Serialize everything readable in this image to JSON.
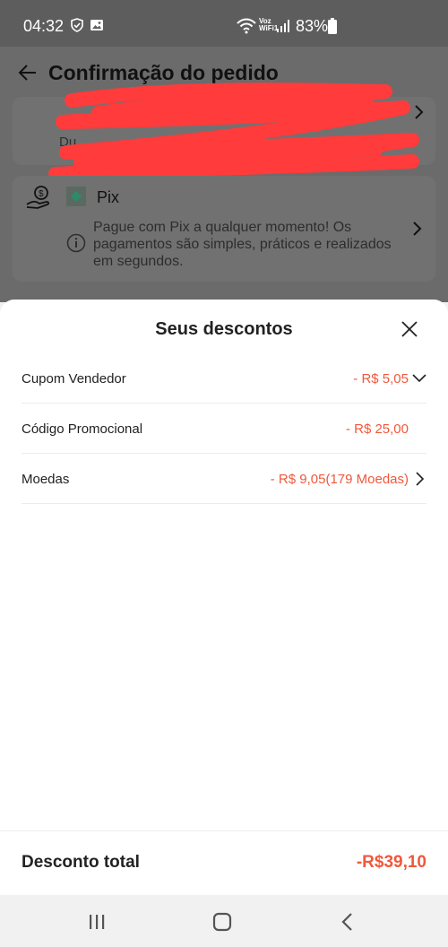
{
  "status_bar": {
    "time": "04:32",
    "network": "Voz WiFi1",
    "battery": "83%"
  },
  "background": {
    "title": "Confirmação do pedido",
    "address_fragment": "Du",
    "payment": {
      "label": "Pix",
      "description": "Pague com Pix a qualquer momento! Os pagamentos são simples, práticos e realizados em segundos."
    }
  },
  "sheet": {
    "title": "Seus descontos",
    "rows": [
      {
        "label": "Cupom Vendedor",
        "value": "- R$ 5,05",
        "icon": "chevron-down-icon"
      },
      {
        "label": "Código Promocional",
        "value": "- R$ 25,00",
        "icon": ""
      },
      {
        "label": "Moedas",
        "value": "- R$ 9,05(179 Moedas)",
        "icon": "chevron-right-icon"
      }
    ]
  },
  "footer": {
    "label": "Desconto total",
    "value": "-R$39,10"
  },
  "colors": {
    "accent": "#f0583c",
    "overlay": "#6b6b6b",
    "redaction": "#ff3b3b"
  }
}
